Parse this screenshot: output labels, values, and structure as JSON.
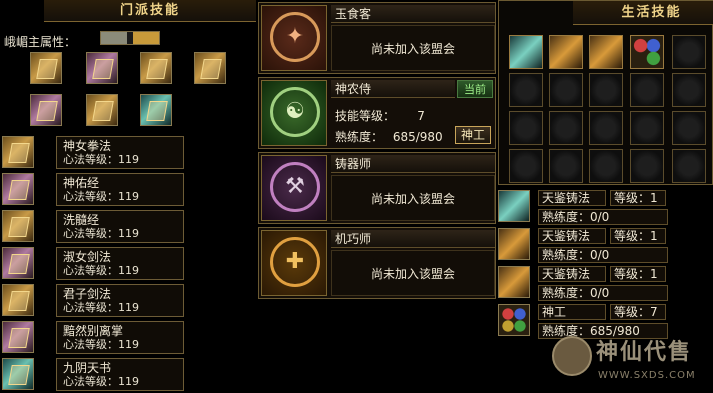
{
  "sect": {
    "title": "门派技能",
    "help": "?",
    "attribute_label": "峨嵋主属性：",
    "skills": [
      {
        "name": "神女拳法",
        "level": "心法等级：119"
      },
      {
        "name": "神佑经",
        "level": "心法等级：119"
      },
      {
        "name": "洗髓经",
        "level": "心法等级：119"
      },
      {
        "name": "淑女剑法",
        "level": "心法等级：119"
      },
      {
        "name": "君子剑法",
        "level": "心法等级：119"
      },
      {
        "name": "黯然别离掌",
        "level": "心法等级：119"
      },
      {
        "name": "九阴天书",
        "level": "心法等级：119"
      }
    ]
  },
  "guilds": [
    {
      "name": "玉食客",
      "status": "尚未加入该盟会",
      "glyph": "✦"
    },
    {
      "name": "神农侍",
      "current": "当前",
      "skill_level_label": "技能等级：",
      "skill_level": "7",
      "prof_label": "熟练度：",
      "prof": "685/980",
      "button": "神工",
      "glyph": "☯"
    },
    {
      "name": "铸器师",
      "status": "尚未加入该盟会",
      "glyph": "⚒"
    },
    {
      "name": "机巧师",
      "status": "尚未加入该盟会",
      "glyph": "✚"
    }
  ],
  "life": {
    "title": "生活技能",
    "help": "?",
    "skills": [
      {
        "name": "天鉴铸法",
        "level": "等级：1",
        "prof": "熟练度：0/0"
      },
      {
        "name": "天鉴铸法",
        "level": "等级：1",
        "prof": "熟练度：0/0"
      },
      {
        "name": "天鉴铸法",
        "level": "等级：1",
        "prof": "熟练度：0/0"
      },
      {
        "name": "神工",
        "level": "等级：7",
        "prof": "熟练度：685/980"
      }
    ]
  },
  "watermark": {
    "text": "神仙代售",
    "url": "WWW.SXDS.COM"
  },
  "colors": {
    "gold": "#f0d48a",
    "border": "#6b5a32",
    "current_green": "#9ff08a"
  }
}
